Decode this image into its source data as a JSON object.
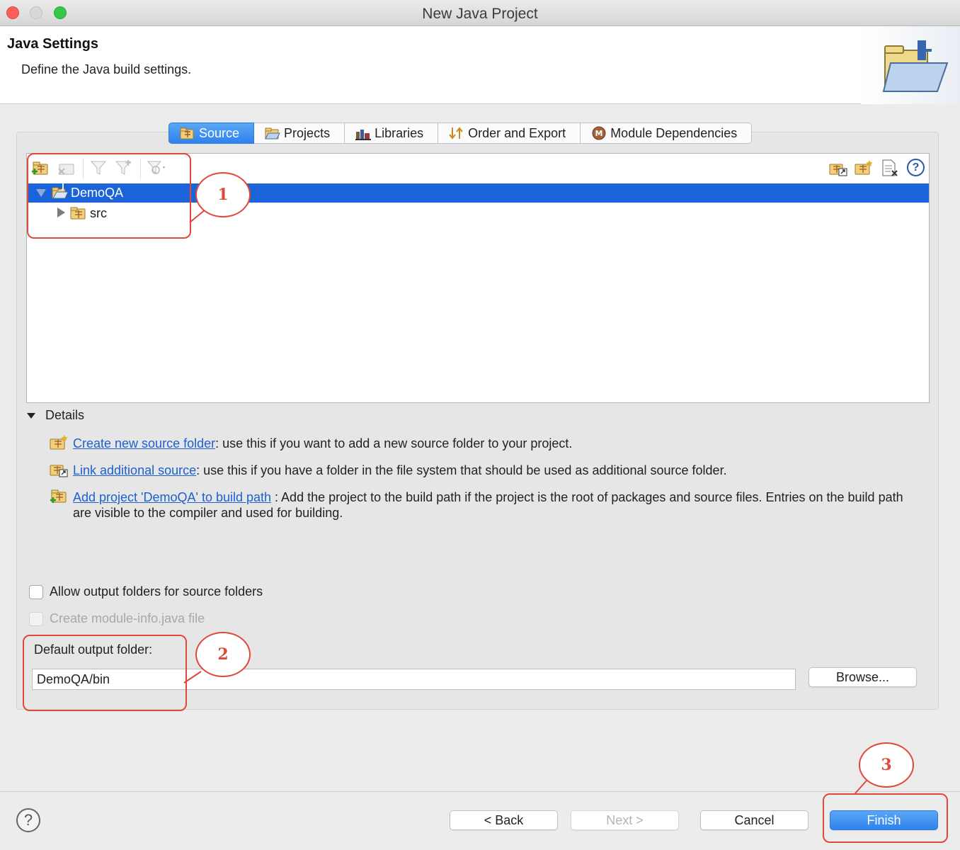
{
  "window": {
    "title": "New Java Project"
  },
  "header": {
    "title": "Java Settings",
    "subtitle": "Define the Java build settings."
  },
  "tabs": [
    {
      "label": "Source",
      "icon": "source-folder-icon",
      "active": true
    },
    {
      "label": "Projects",
      "icon": "projects-icon",
      "active": false
    },
    {
      "label": "Libraries",
      "icon": "libraries-icon",
      "active": false
    },
    {
      "label": "Order and Export",
      "icon": "order-export-icon",
      "active": false
    },
    {
      "label": "Module Dependencies",
      "icon": "module-icon",
      "active": false
    }
  ],
  "tree": {
    "root": {
      "label": "DemoQA",
      "expanded": true,
      "selected": true
    },
    "children": [
      {
        "label": "src",
        "expanded": false
      }
    ]
  },
  "details": {
    "heading": "Details",
    "items": [
      {
        "link": "Create new source folder",
        "text": ": use this if you want to add a new source folder to your project."
      },
      {
        "link": "Link additional source",
        "text": ": use this if you have a folder in the file system that should be used as additional source folder."
      },
      {
        "link": "Add project 'DemoQA' to build path",
        "text": ": Add the project to the build path if the project is the root of packages and source files. Entries on the build path are visible to the compiler and used for building."
      }
    ]
  },
  "options": {
    "allow_output": {
      "label": "Allow output folders for source folders",
      "checked": false
    },
    "module_info": {
      "label": "Create module-info.java file",
      "checked": false,
      "disabled": true
    }
  },
  "output": {
    "label": "Default output folder:",
    "value": "DemoQA/bin",
    "browse": "Browse..."
  },
  "buttons": {
    "back": "< Back",
    "next": "Next >",
    "cancel": "Cancel",
    "finish": "Finish"
  },
  "help": "?",
  "annotations": [
    "1",
    "2",
    "3"
  ],
  "colors": {
    "accent": "#2f82ee",
    "selection": "#1b63d8",
    "annotation": "#e0493a",
    "link": "#1f5fce"
  }
}
